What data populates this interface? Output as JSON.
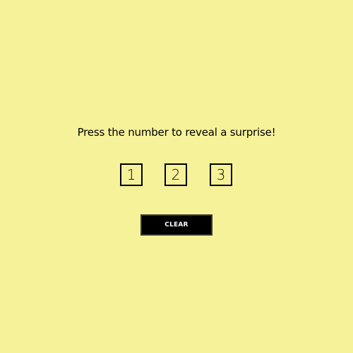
{
  "prompt": {
    "text": "Press the number to reveal a surprise!"
  },
  "number_buttons": [
    {
      "label": "1"
    },
    {
      "label": "2"
    },
    {
      "label": "3"
    }
  ],
  "clear_button": {
    "label": "CLEAR"
  },
  "colors": {
    "background": "#f6f29a",
    "button_border": "#000000",
    "clear_background": "#000000",
    "clear_text": "#ffffff"
  }
}
